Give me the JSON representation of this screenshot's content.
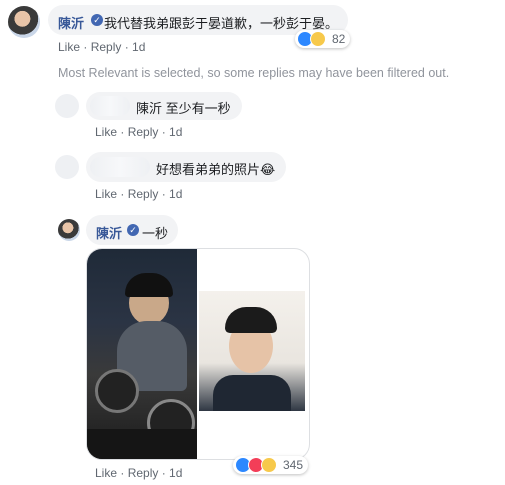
{
  "comment_top": {
    "author": "陳沂",
    "text": "我代替我弟跟彭于晏道歉，一秒彭于晏。",
    "actions": {
      "like": "Like",
      "reply": "Reply",
      "time": "1d"
    },
    "reaction_count": "82",
    "reactions": [
      "like-reaction-icon",
      "haha-reaction-icon"
    ]
  },
  "filter_notice": "Most Relevant is selected, so some replies may have been filtered out.",
  "replies": [
    {
      "text": "陳沂 至少有一秒",
      "actions": {
        "like": "Like",
        "reply": "Reply",
        "time": "1d"
      }
    },
    {
      "text": "好想看弟弟的照片😂",
      "actions": {
        "like": "Like",
        "reply": "Reply",
        "time": "1d"
      }
    }
  ],
  "reply_chenyi": {
    "author": "陳沂",
    "text": "一秒",
    "actions": {
      "like": "Like",
      "reply": "Reply",
      "time": "1d"
    },
    "reaction_count": "345",
    "reactions": [
      "like-reaction-icon",
      "love-reaction-icon",
      "wow-reaction-icon"
    ]
  },
  "colors": {
    "link": "#385898",
    "meta": "#606770",
    "bubble": "#f2f3f5",
    "accent": "#4267b2"
  }
}
